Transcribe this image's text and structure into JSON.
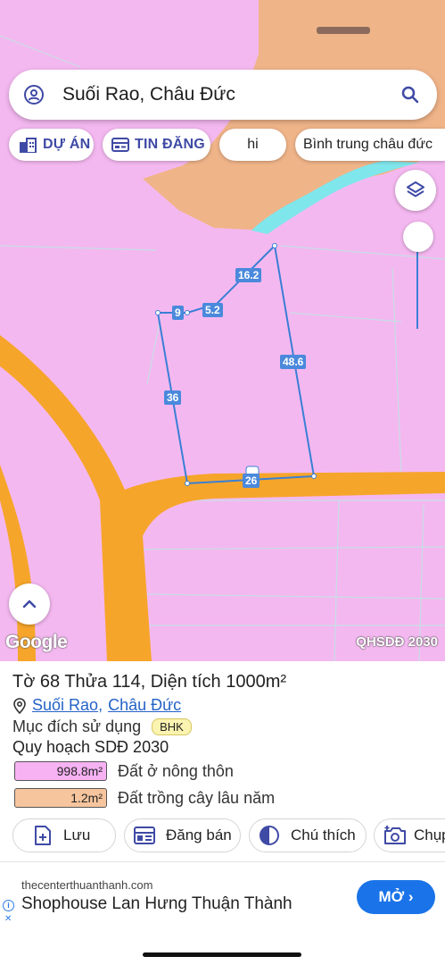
{
  "search": {
    "query": "Suối Rao, Châu Đức"
  },
  "chips": [
    {
      "label": "DỰ ÁN",
      "icon": "building-icon"
    },
    {
      "label": "TIN ĐĂNG",
      "icon": "listing-icon"
    },
    {
      "label": "hi"
    },
    {
      "label": "Bình trung châu đức"
    }
  ],
  "parcel_edges": [
    {
      "label": "16.2"
    },
    {
      "label": "5.2"
    },
    {
      "label": "9"
    },
    {
      "label": "48.6"
    },
    {
      "label": "36"
    },
    {
      "label": "26"
    }
  ],
  "map": {
    "logo": "Google",
    "source": "QHSDĐ 2030",
    "colors": {
      "residential": "#f4b8f0",
      "perennial": "#f0b489",
      "road": "#f6a52b",
      "water": "#7fe6ec",
      "parcel": "#4a89dc"
    }
  },
  "info": {
    "title": "Tờ 68 Thửa 114, Diện tích 1000m²",
    "location": {
      "commune": "Suối Rao",
      "separator": ",",
      "district": "Châu Đức"
    },
    "purpose_label": "Mục đích sử dụng",
    "purpose_code": "BHK",
    "plan_title": "Quy hoạch SDĐ 2030",
    "areas": [
      {
        "value": "998.8m²",
        "label": "Đất ở nông thôn",
        "color": "#f7b2f3"
      },
      {
        "value": "1.2m²",
        "label": "Đất trồng cây lâu năm",
        "color": "#f6c59e"
      }
    ]
  },
  "actions": [
    {
      "label": "Lưu",
      "icon": "save-plus-icon"
    },
    {
      "label": "Đăng bán",
      "icon": "calendar-post-icon"
    },
    {
      "label": "Chú thích",
      "icon": "legend-half-circle-icon"
    },
    {
      "label": "Chụp",
      "icon": "camera-add-icon"
    }
  ],
  "ad": {
    "url": "thecenterthuanthanh.com",
    "title": "Shophouse Lan Hưng Thuận Thành",
    "button": "MỞ ›",
    "info_symbol": "i",
    "close_symbol": "✕"
  }
}
